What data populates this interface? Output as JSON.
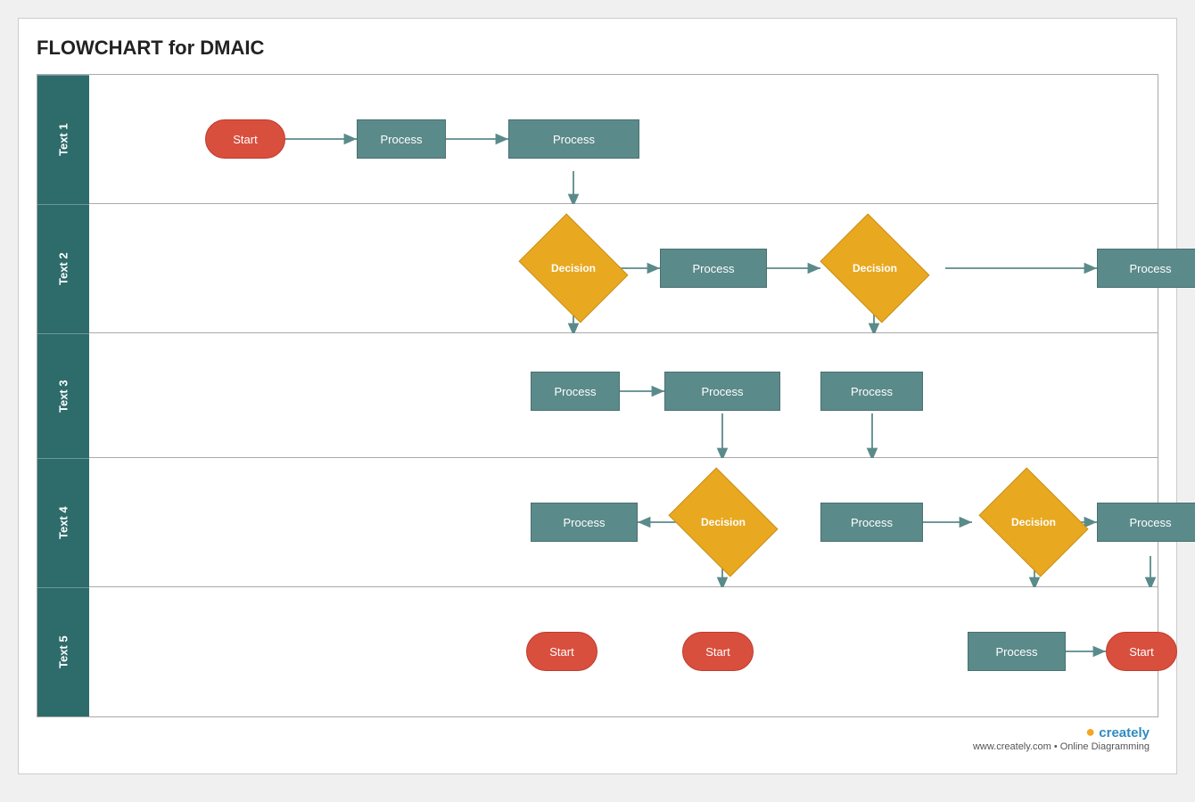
{
  "title": "FLOWCHART for DMAIC",
  "lanes": [
    {
      "label": "Text 1"
    },
    {
      "label": "Text 2"
    },
    {
      "label": "Text 3"
    },
    {
      "label": "Text 4"
    },
    {
      "label": "Text 5"
    }
  ],
  "shapes": {
    "start1": "Start",
    "process1": "Process",
    "process2": "Process",
    "decision1": "Decision",
    "process3": "Process",
    "decision2": "Decision",
    "process4": "Process",
    "process5": "Process",
    "process6": "Process",
    "process7": "Process",
    "decision3": "Decision",
    "process8": "Process",
    "process9": "Process",
    "decision4": "Decision",
    "process10": "Process",
    "start2": "Start",
    "start3": "Start",
    "process11": "Process",
    "start4": "Start"
  },
  "footer": {
    "brand": "creately",
    "url": "www.creately.com • Online Diagramming"
  }
}
